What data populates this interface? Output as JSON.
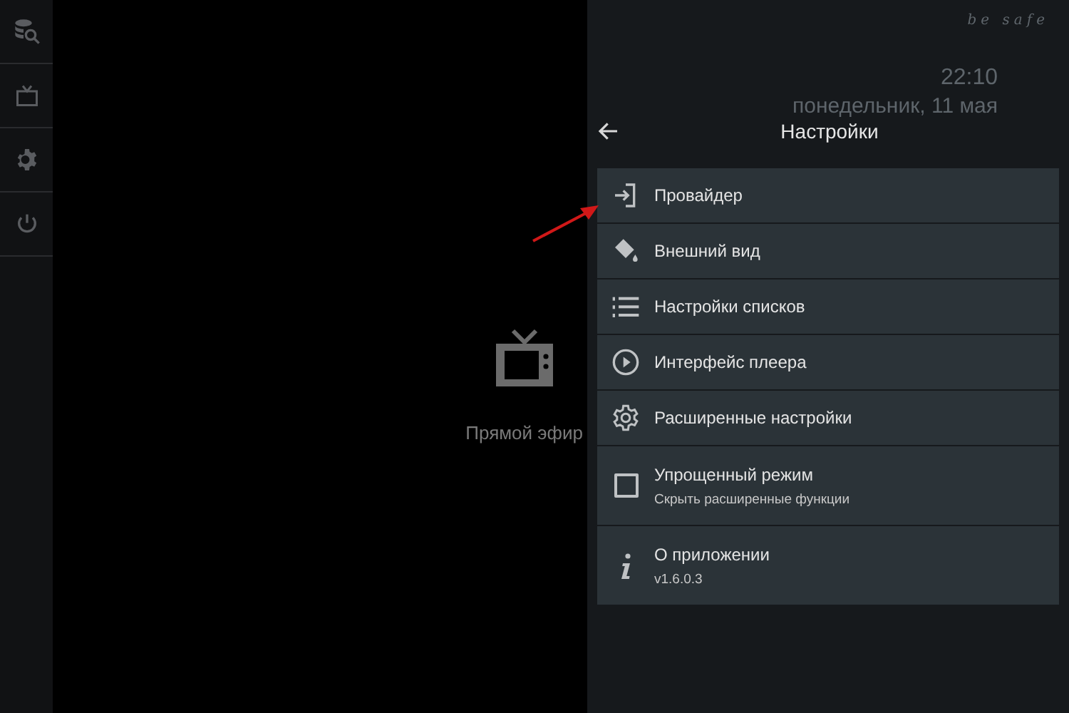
{
  "sidebar": {
    "items": [
      {
        "selected": false
      },
      {
        "selected": false
      },
      {
        "selected": false
      },
      {
        "selected": false
      }
    ]
  },
  "main": {
    "label": "Прямой эфир"
  },
  "panel": {
    "motto": "be safe",
    "time": "22:10",
    "date": "понедельник, 11 мая",
    "title": "Настройки",
    "items": [
      {
        "kind": "nav",
        "label": "Провайдер"
      },
      {
        "kind": "nav",
        "label": "Внешний вид"
      },
      {
        "kind": "nav",
        "label": "Настройки списков"
      },
      {
        "kind": "nav",
        "label": "Интерфейс плеера"
      },
      {
        "kind": "nav",
        "label": "Расширенные настройки"
      },
      {
        "kind": "checkbox",
        "checked": false,
        "label": "Упрощенный режим",
        "sub": "Скрыть расширенные функции"
      },
      {
        "kind": "info",
        "label": "О приложении",
        "sub": "v1.6.0.3"
      }
    ]
  }
}
